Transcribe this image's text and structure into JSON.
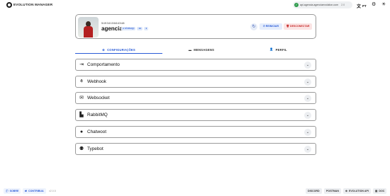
{
  "app": {
    "title": "EVOLUTION MANAGER"
  },
  "header": {
    "api_url": "api.agencia.agenciaevolution.com",
    "api_version": "2.0",
    "language": "PT"
  },
  "instance": {
    "id": "5493415664348",
    "name": "agencia",
    "chips": [
      "● whatsapp",
      "●●",
      "●"
    ],
    "restart_label": "REINICIAR",
    "disconnect_label": "DESCONECTAR"
  },
  "tabs": [
    {
      "label": "CONFIGURAÇÕES",
      "active": true
    },
    {
      "label": "MENSAGENS",
      "active": false
    },
    {
      "label": "PERFIL",
      "active": false
    }
  ],
  "sections": [
    {
      "label": "Comportamento",
      "icon": "behavior-icon"
    },
    {
      "label": "Webhook",
      "icon": "webhook-icon"
    },
    {
      "label": "Websocket",
      "icon": "websocket-icon"
    },
    {
      "label": "RabbitMQ",
      "icon": "rabbitmq-icon"
    },
    {
      "label": "Chatwoot",
      "icon": "chatwoot-icon"
    },
    {
      "label": "Typebot",
      "icon": "typebot-icon"
    }
  ],
  "footer": {
    "about_label": "SOBRE",
    "contrib_label": "CONTRIBUA",
    "version": "v2.0.5",
    "discord_label": "DISCORD",
    "postman_label": "POSTMAN",
    "api_label": "EVOLUTION API",
    "doc_label": "DOC"
  },
  "colors": {
    "accent": "#2a5bd7",
    "danger": "#c62828",
    "success": "#2e9b4b"
  }
}
